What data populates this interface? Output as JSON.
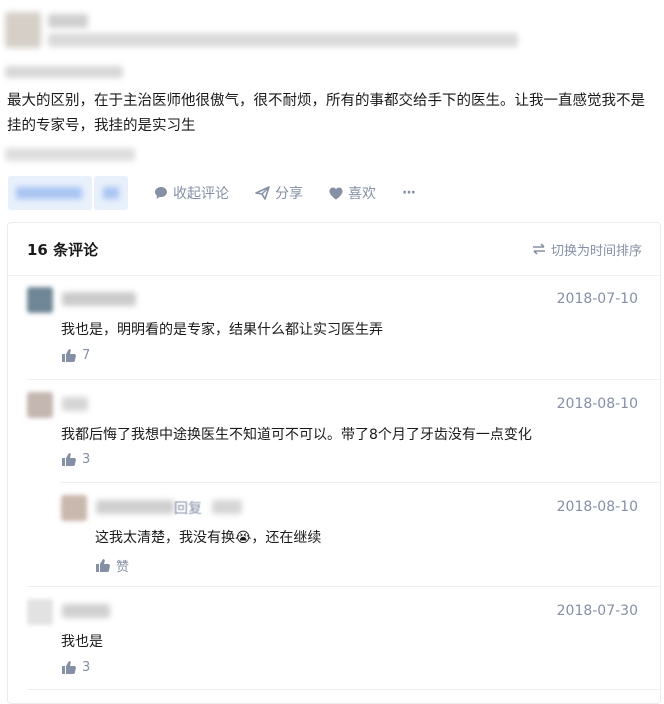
{
  "answer": {
    "text": "最大的区别，在于主治医师他很傲气，很不耐烦，所有的事都交给手下的医生。让我一直感觉我不是挂的专家号，我挂的是实习生"
  },
  "actions": {
    "collapse_comments": "收起评论",
    "share": "分享",
    "like": "喜欢",
    "more": "···"
  },
  "comments": {
    "count_label": "16 条评论",
    "sort_label": "切换为时间排序",
    "items": [
      {
        "date": "2018-07-10",
        "text": "我也是，明明看的是专家，结果什么都让实习医生弄",
        "likes": "7"
      },
      {
        "date": "2018-08-10",
        "text": "我都后悔了我想中途换医生不知道可不可以。带了8个月了牙齿没有一点变化",
        "likes": "3"
      },
      {
        "date": "2018-08-10",
        "reply_word": "回复",
        "text": "这我太清楚，我没有换😭，还在继续",
        "likes": "赞"
      },
      {
        "date": "2018-07-30",
        "text": "我也是",
        "likes": "3"
      }
    ]
  },
  "colors": {
    "accent": "#0084ff",
    "muted": "#8590a6"
  }
}
